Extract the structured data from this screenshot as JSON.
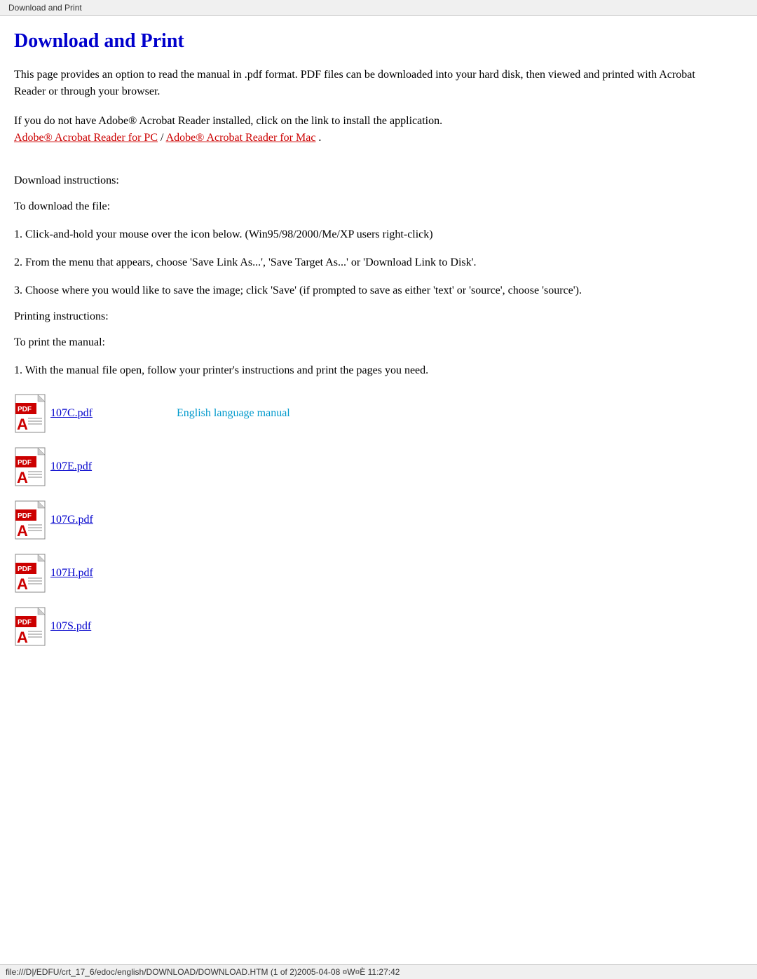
{
  "browser_tab": {
    "title": "Download and Print"
  },
  "page": {
    "title": "Download and Print",
    "intro_paragraph1": "This page provides an option to read the manual in .pdf format. PDF files can be downloaded into your hard disk, then viewed and printed with Acrobat Reader or through your browser.",
    "intro_paragraph2": "If you do not have Adobe® Acrobat Reader installed, click on the link to install the application.",
    "link_pc": "Adobe® Acrobat Reader for PC",
    "link_mac": "Adobe® Acrobat Reader for Mac",
    "download_heading": "Download instructions:",
    "download_intro": "To download the file:",
    "download_step1": "1. Click-and-hold your mouse over the icon below. (Win95/98/2000/Me/XP users right-click)",
    "download_step2": "2. From the menu that appears, choose 'Save Link As...', 'Save Target As...' or 'Download Link to Disk'.",
    "download_step3": "3. Choose where you would like to save the image; click 'Save' (if prompted to save as either 'text' or 'source', choose 'source').",
    "print_heading": "Printing instructions:",
    "print_intro": "To print the manual:",
    "print_step1": "1. With the manual file open, follow your printer's instructions and print the pages you need.",
    "pdf_files": [
      {
        "name": "107C.pdf",
        "description": "English language manual"
      },
      {
        "name": "107E.pdf",
        "description": ""
      },
      {
        "name": "107G.pdf",
        "description": ""
      },
      {
        "name": "107H.pdf",
        "description": ""
      },
      {
        "name": "107S.pdf",
        "description": ""
      }
    ]
  },
  "status_bar": {
    "text": "file:///D|/EDFU/crt_17_6/edoc/english/DOWNLOAD/DOWNLOAD.HTM (1 of 2)2005-04-08 ¤W¤È 11:27:42"
  }
}
